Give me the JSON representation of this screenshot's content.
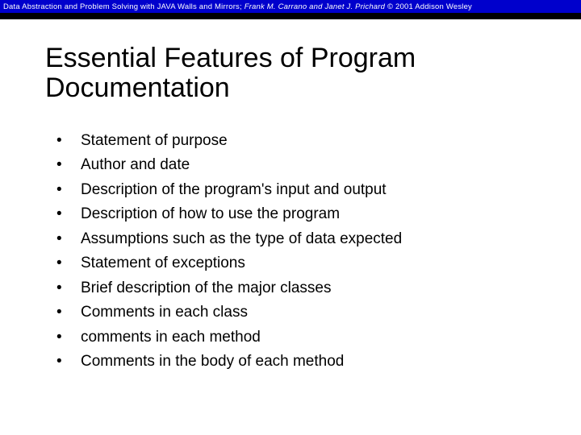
{
  "header": {
    "book_title": "Data Abstraction and Problem Solving with JAVA",
    "subtitle_prefix": "  Walls and Mirrors; ",
    "authors": "Frank M. Carrano and Janet J. Prichard",
    "copyright": "   © 2001 Addison Wesley"
  },
  "slide": {
    "title": "Essential Features of Program Documentation",
    "bullets": [
      "Statement of purpose",
      "Author and date",
      "Description of the program's input and output",
      "Description of how to use the program",
      "Assumptions such as the type of data expected",
      "Statement of exceptions",
      "Brief description of the major classes",
      "Comments in each class",
      "comments in each method",
      "Comments in the body of each method"
    ]
  }
}
